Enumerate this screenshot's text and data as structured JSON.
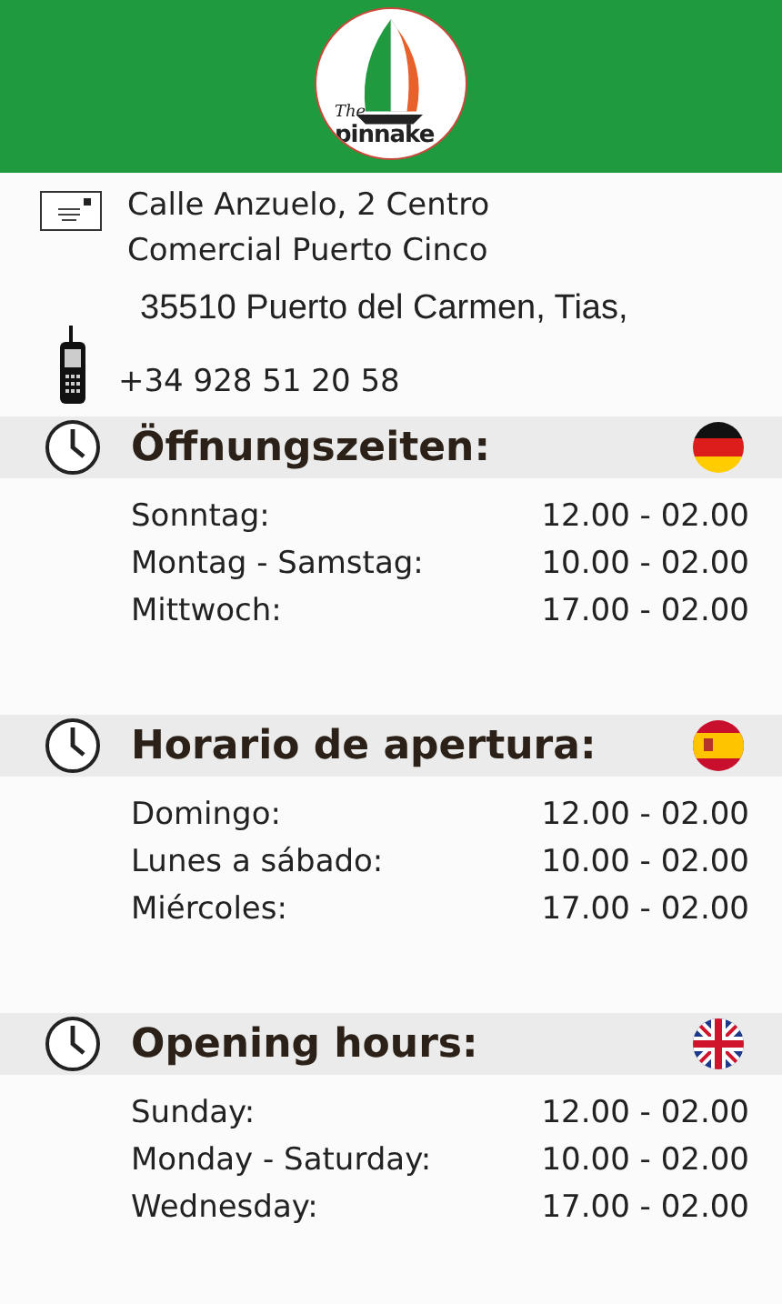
{
  "logo": {
    "texts": [
      "The",
      "pinnake"
    ]
  },
  "contact": {
    "address_lines": [
      "Calle Anzuelo, 2 Centro",
      "Comercial Puerto Cinco"
    ],
    "city": "35510 Puerto del Carmen, Tias,",
    "phone": "+34 928 51 20 58"
  },
  "sections": [
    {
      "title": "Öffnungszeiten:",
      "kind": "de",
      "rows": [
        {
          "day": "Sonntag:",
          "hours": "12.00 - 02.00"
        },
        {
          "day": "Montag - Samstag:",
          "hours": "10.00 - 02.00"
        },
        {
          "day": "Mittwoch:",
          "hours": "17.00 - 02.00"
        }
      ]
    },
    {
      "title": "Horario de apertura:",
      "kind": "es",
      "rows": [
        {
          "day": "Domingo:",
          "hours": "12.00 - 02.00"
        },
        {
          "day": "Lunes a sábado:",
          "hours": "10.00 - 02.00"
        },
        {
          "day": "Miércoles:",
          "hours": "17.00 - 02.00"
        }
      ]
    },
    {
      "title": "Opening hours:",
      "kind": "gb",
      "rows": [
        {
          "day": "Sunday:",
          "hours": "12.00 - 02.00"
        },
        {
          "day": "Monday - Saturday:",
          "hours": "10.00 - 02.00"
        },
        {
          "day": "Wednesday:",
          "hours": "17.00 - 02.00"
        }
      ]
    }
  ]
}
